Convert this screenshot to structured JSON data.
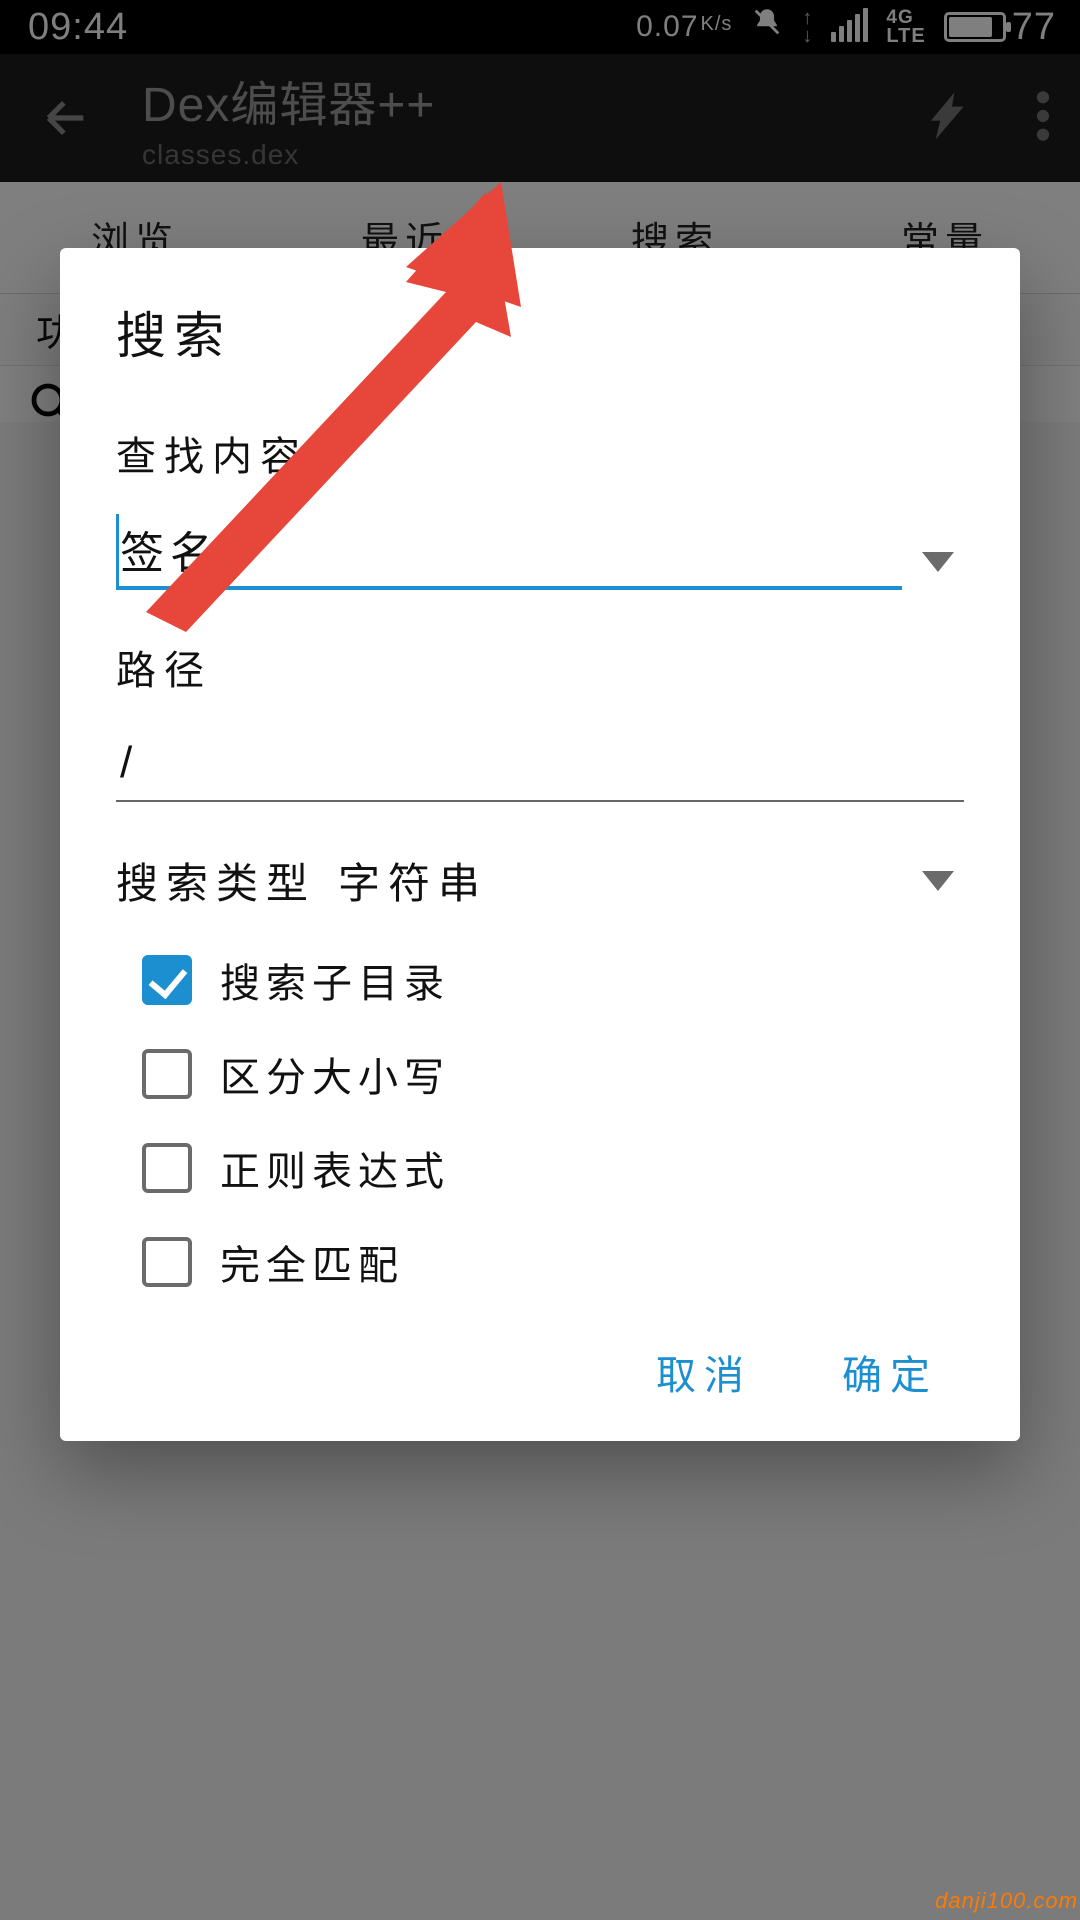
{
  "status": {
    "time": "09:44",
    "net_speed_value": "0.07",
    "net_speed_unit": "K/s",
    "lte_top": "4G",
    "lte_bottom": "LTE",
    "battery_percent": "77"
  },
  "appbar": {
    "title": "Dex编辑器++",
    "subtitle": "classes.dex"
  },
  "tabs": [
    "浏览",
    "最近",
    "搜索",
    "常量"
  ],
  "subbar": {
    "label": "功"
  },
  "dialog": {
    "title": "搜索",
    "field_find_label": "查找内容",
    "find_value": "签名",
    "field_path_label": "路径",
    "path_value": "/",
    "type_label": "搜索类型",
    "type_value": "字符串",
    "checks": [
      {
        "label": "搜索子目录",
        "checked": true
      },
      {
        "label": "区分大小写",
        "checked": false
      },
      {
        "label": "正则表达式",
        "checked": false
      },
      {
        "label": "完全匹配",
        "checked": false
      }
    ],
    "cancel": "取消",
    "ok": "确定"
  },
  "watermark": "danji100.com"
}
